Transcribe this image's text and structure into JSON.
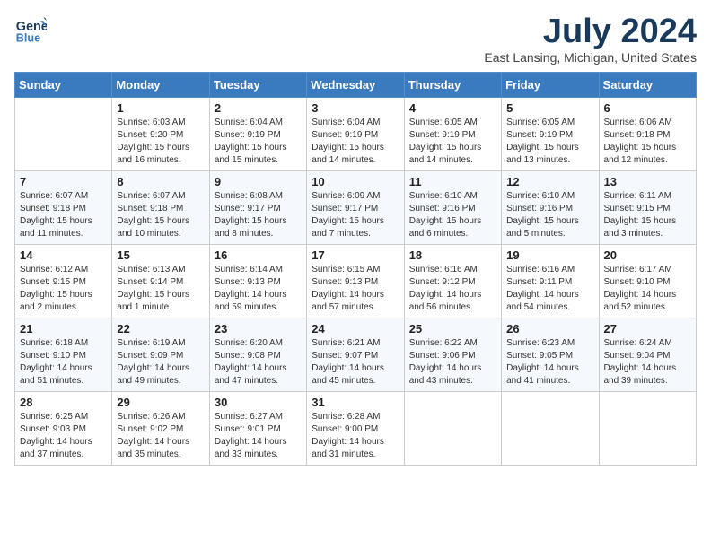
{
  "header": {
    "logo_line1": "General",
    "logo_line2": "Blue",
    "month_year": "July 2024",
    "location": "East Lansing, Michigan, United States"
  },
  "weekdays": [
    "Sunday",
    "Monday",
    "Tuesday",
    "Wednesday",
    "Thursday",
    "Friday",
    "Saturday"
  ],
  "weeks": [
    [
      {
        "day": "",
        "sunrise": "",
        "sunset": "",
        "daylight": ""
      },
      {
        "day": "1",
        "sunrise": "Sunrise: 6:03 AM",
        "sunset": "Sunset: 9:20 PM",
        "daylight": "Daylight: 15 hours and 16 minutes."
      },
      {
        "day": "2",
        "sunrise": "Sunrise: 6:04 AM",
        "sunset": "Sunset: 9:19 PM",
        "daylight": "Daylight: 15 hours and 15 minutes."
      },
      {
        "day": "3",
        "sunrise": "Sunrise: 6:04 AM",
        "sunset": "Sunset: 9:19 PM",
        "daylight": "Daylight: 15 hours and 14 minutes."
      },
      {
        "day": "4",
        "sunrise": "Sunrise: 6:05 AM",
        "sunset": "Sunset: 9:19 PM",
        "daylight": "Daylight: 15 hours and 14 minutes."
      },
      {
        "day": "5",
        "sunrise": "Sunrise: 6:05 AM",
        "sunset": "Sunset: 9:19 PM",
        "daylight": "Daylight: 15 hours and 13 minutes."
      },
      {
        "day": "6",
        "sunrise": "Sunrise: 6:06 AM",
        "sunset": "Sunset: 9:18 PM",
        "daylight": "Daylight: 15 hours and 12 minutes."
      }
    ],
    [
      {
        "day": "7",
        "sunrise": "Sunrise: 6:07 AM",
        "sunset": "Sunset: 9:18 PM",
        "daylight": "Daylight: 15 hours and 11 minutes."
      },
      {
        "day": "8",
        "sunrise": "Sunrise: 6:07 AM",
        "sunset": "Sunset: 9:18 PM",
        "daylight": "Daylight: 15 hours and 10 minutes."
      },
      {
        "day": "9",
        "sunrise": "Sunrise: 6:08 AM",
        "sunset": "Sunset: 9:17 PM",
        "daylight": "Daylight: 15 hours and 8 minutes."
      },
      {
        "day": "10",
        "sunrise": "Sunrise: 6:09 AM",
        "sunset": "Sunset: 9:17 PM",
        "daylight": "Daylight: 15 hours and 7 minutes."
      },
      {
        "day": "11",
        "sunrise": "Sunrise: 6:10 AM",
        "sunset": "Sunset: 9:16 PM",
        "daylight": "Daylight: 15 hours and 6 minutes."
      },
      {
        "day": "12",
        "sunrise": "Sunrise: 6:10 AM",
        "sunset": "Sunset: 9:16 PM",
        "daylight": "Daylight: 15 hours and 5 minutes."
      },
      {
        "day": "13",
        "sunrise": "Sunrise: 6:11 AM",
        "sunset": "Sunset: 9:15 PM",
        "daylight": "Daylight: 15 hours and 3 minutes."
      }
    ],
    [
      {
        "day": "14",
        "sunrise": "Sunrise: 6:12 AM",
        "sunset": "Sunset: 9:15 PM",
        "daylight": "Daylight: 15 hours and 2 minutes."
      },
      {
        "day": "15",
        "sunrise": "Sunrise: 6:13 AM",
        "sunset": "Sunset: 9:14 PM",
        "daylight": "Daylight: 15 hours and 1 minute."
      },
      {
        "day": "16",
        "sunrise": "Sunrise: 6:14 AM",
        "sunset": "Sunset: 9:13 PM",
        "daylight": "Daylight: 14 hours and 59 minutes."
      },
      {
        "day": "17",
        "sunrise": "Sunrise: 6:15 AM",
        "sunset": "Sunset: 9:13 PM",
        "daylight": "Daylight: 14 hours and 57 minutes."
      },
      {
        "day": "18",
        "sunrise": "Sunrise: 6:16 AM",
        "sunset": "Sunset: 9:12 PM",
        "daylight": "Daylight: 14 hours and 56 minutes."
      },
      {
        "day": "19",
        "sunrise": "Sunrise: 6:16 AM",
        "sunset": "Sunset: 9:11 PM",
        "daylight": "Daylight: 14 hours and 54 minutes."
      },
      {
        "day": "20",
        "sunrise": "Sunrise: 6:17 AM",
        "sunset": "Sunset: 9:10 PM",
        "daylight": "Daylight: 14 hours and 52 minutes."
      }
    ],
    [
      {
        "day": "21",
        "sunrise": "Sunrise: 6:18 AM",
        "sunset": "Sunset: 9:10 PM",
        "daylight": "Daylight: 14 hours and 51 minutes."
      },
      {
        "day": "22",
        "sunrise": "Sunrise: 6:19 AM",
        "sunset": "Sunset: 9:09 PM",
        "daylight": "Daylight: 14 hours and 49 minutes."
      },
      {
        "day": "23",
        "sunrise": "Sunrise: 6:20 AM",
        "sunset": "Sunset: 9:08 PM",
        "daylight": "Daylight: 14 hours and 47 minutes."
      },
      {
        "day": "24",
        "sunrise": "Sunrise: 6:21 AM",
        "sunset": "Sunset: 9:07 PM",
        "daylight": "Daylight: 14 hours and 45 minutes."
      },
      {
        "day": "25",
        "sunrise": "Sunrise: 6:22 AM",
        "sunset": "Sunset: 9:06 PM",
        "daylight": "Daylight: 14 hours and 43 minutes."
      },
      {
        "day": "26",
        "sunrise": "Sunrise: 6:23 AM",
        "sunset": "Sunset: 9:05 PM",
        "daylight": "Daylight: 14 hours and 41 minutes."
      },
      {
        "day": "27",
        "sunrise": "Sunrise: 6:24 AM",
        "sunset": "Sunset: 9:04 PM",
        "daylight": "Daylight: 14 hours and 39 minutes."
      }
    ],
    [
      {
        "day": "28",
        "sunrise": "Sunrise: 6:25 AM",
        "sunset": "Sunset: 9:03 PM",
        "daylight": "Daylight: 14 hours and 37 minutes."
      },
      {
        "day": "29",
        "sunrise": "Sunrise: 6:26 AM",
        "sunset": "Sunset: 9:02 PM",
        "daylight": "Daylight: 14 hours and 35 minutes."
      },
      {
        "day": "30",
        "sunrise": "Sunrise: 6:27 AM",
        "sunset": "Sunset: 9:01 PM",
        "daylight": "Daylight: 14 hours and 33 minutes."
      },
      {
        "day": "31",
        "sunrise": "Sunrise: 6:28 AM",
        "sunset": "Sunset: 9:00 PM",
        "daylight": "Daylight: 14 hours and 31 minutes."
      },
      {
        "day": "",
        "sunrise": "",
        "sunset": "",
        "daylight": ""
      },
      {
        "day": "",
        "sunrise": "",
        "sunset": "",
        "daylight": ""
      },
      {
        "day": "",
        "sunrise": "",
        "sunset": "",
        "daylight": ""
      }
    ]
  ]
}
